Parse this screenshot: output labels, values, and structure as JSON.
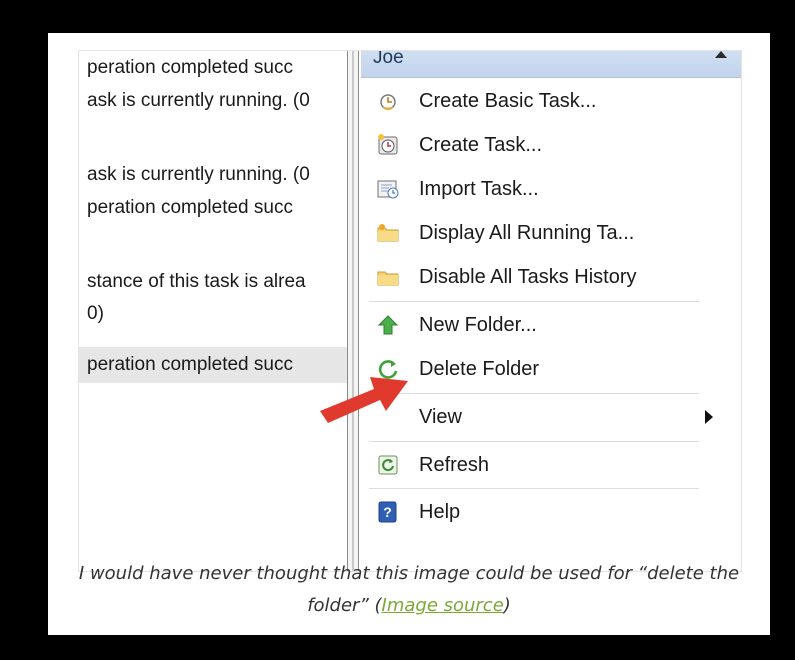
{
  "left_pane": {
    "rows": [
      "peration completed succ",
      "ask is currently running. (0",
      "",
      "ask is currently running. (0",
      "peration completed succ",
      "",
      "stance of this task is alrea",
      "0)",
      "peration completed succ"
    ]
  },
  "menu": {
    "header": "Joe",
    "items": [
      {
        "label": "Create Basic Task...",
        "icon": "clock-wizard-icon"
      },
      {
        "label": "Create Task...",
        "icon": "task-clock-icon"
      },
      {
        "label": "Import Task...",
        "icon": "import-task-icon"
      },
      {
        "label": "Display All Running Ta...",
        "icon": "folder-running-icon"
      },
      {
        "label": "Disable All Tasks History",
        "icon": "folder-history-icon"
      },
      {
        "label": "New Folder...",
        "icon": "green-up-arrow-icon"
      },
      {
        "label": "Delete Folder",
        "icon": "green-refresh-circle-icon"
      },
      {
        "label": "View",
        "icon": "none"
      },
      {
        "label": "Refresh",
        "icon": "refresh-icon"
      },
      {
        "label": "Help",
        "icon": "help-icon"
      }
    ]
  },
  "caption": {
    "text": "I would have never thought that this image could be used for “delete the folder” (",
    "link_text": "Image source",
    "suffix": ")"
  },
  "colors": {
    "pointer_arrow": "#e03a2e",
    "header_blue": "#c8d8ee",
    "link_green": "#7aa935"
  }
}
